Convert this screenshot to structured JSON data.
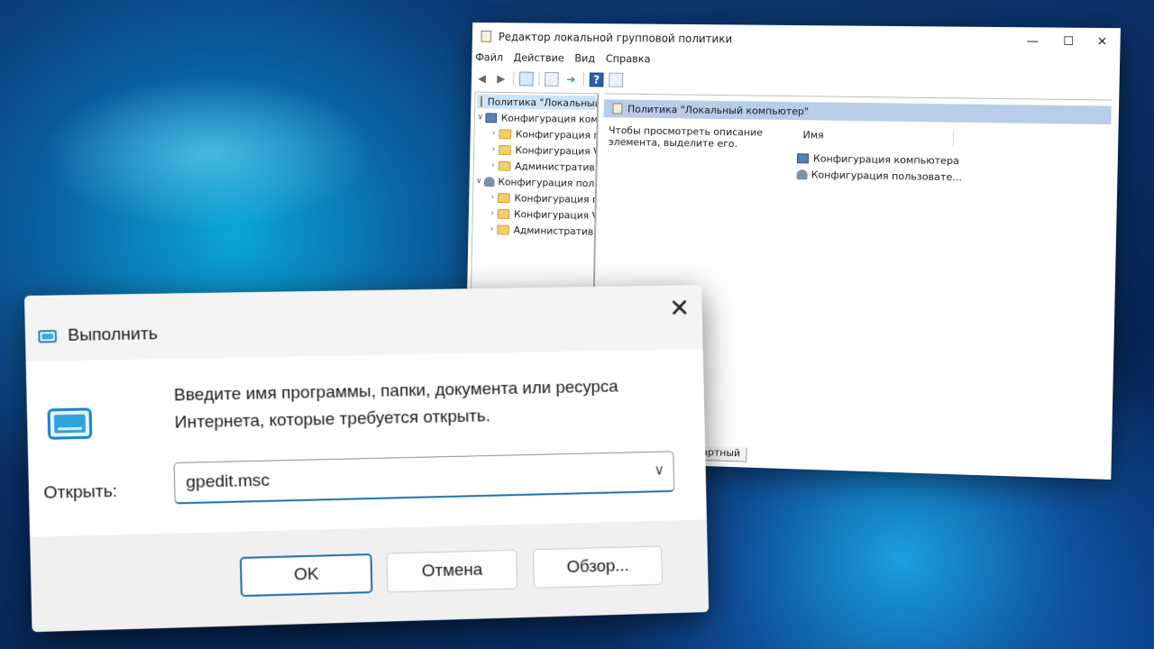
{
  "gpedit": {
    "title": "Редактор локальной групповой политики",
    "controls": {
      "minimize": "—",
      "maximize": "☐",
      "close": "✕"
    },
    "menu": [
      "Файл",
      "Действие",
      "Вид",
      "Справка"
    ],
    "tree": {
      "root": "Политика \"Локальный",
      "items": [
        {
          "label": "Конфигурация комп",
          "chevron": "∨",
          "kind": "pc"
        },
        {
          "label": "Конфигурация п",
          "chevron": "›",
          "kind": "folder"
        },
        {
          "label": "Конфигурация V",
          "chevron": "›",
          "kind": "folder"
        },
        {
          "label": "Административ",
          "chevron": "›",
          "kind": "folder"
        },
        {
          "label": "Конфигурация пол",
          "chevron": "∨",
          "kind": "user"
        },
        {
          "label": "Конфигурация п",
          "chevron": "›",
          "kind": "folder"
        },
        {
          "label": "Конфигурация V",
          "chevron": "›",
          "kind": "folder"
        },
        {
          "label": "Административ",
          "chevron": "›",
          "kind": "folder"
        }
      ]
    },
    "pane": {
      "header": "Политика \"Локальный компьютер\"",
      "description": "Чтобы просмотреть описание элемента, выделите его.",
      "column_name": "Имя",
      "items": [
        "Конфигурация компьютера",
        "Конфигурация пользовате..."
      ]
    },
    "tab": "андартный"
  },
  "run": {
    "title": "Выполнить",
    "close": "✕",
    "prompt": "Введите имя программы, папки, документа или ресурса Интернета, которые требуется открыть.",
    "open_label": "Открыть:",
    "value": "gpedit.msc",
    "buttons": {
      "ok": "OK",
      "cancel": "Отмена",
      "browse": "Обзор..."
    }
  }
}
